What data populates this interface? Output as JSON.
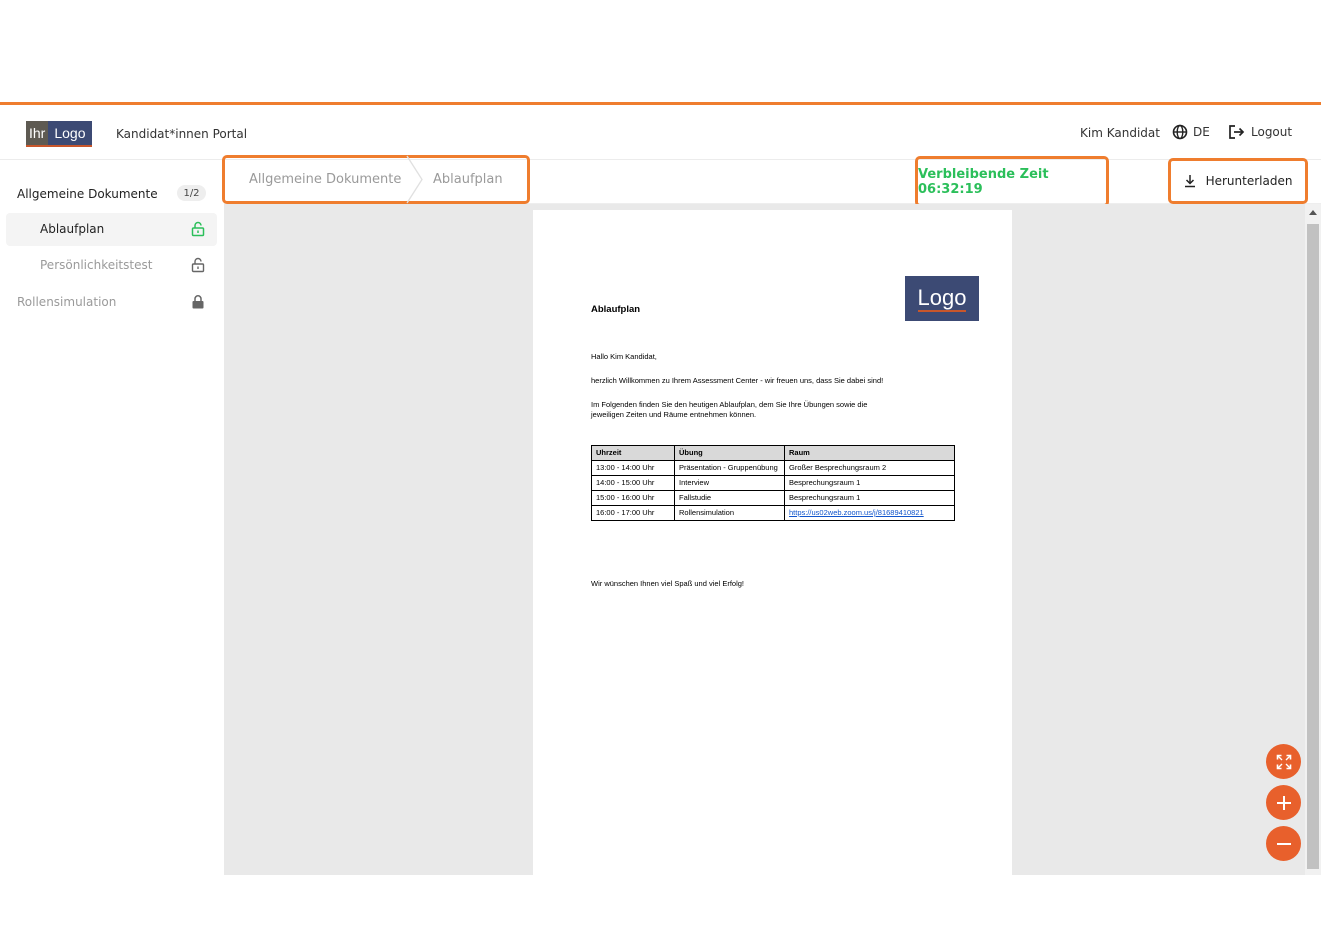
{
  "header": {
    "logo": {
      "part1": "Ihr",
      "part2": "Logo"
    },
    "portal_title": "Kandidat*innen Portal",
    "user_name": "Kim Kandidat",
    "language": "DE",
    "logout_label": "Logout"
  },
  "sidebar": {
    "section_title": "Allgemeine Dokumente",
    "counter": "1/2",
    "items": [
      {
        "label": "Ablaufplan",
        "icon": "unlock-icon",
        "state": "active"
      },
      {
        "label": "Persönlichkeitstest",
        "icon": "unlock-icon",
        "state": "inactive"
      }
    ],
    "locked_section": {
      "label": "Rollensimulation",
      "icon": "lock-icon"
    }
  },
  "toolbar": {
    "breadcrumb": [
      "Allgemeine Dokumente",
      "Ablaufplan"
    ],
    "timer": "Verbleibende Zeit 06:32:19",
    "download_label": "Herunterladen"
  },
  "document": {
    "logo": "Logo",
    "title": "Ablaufplan",
    "greeting": "Hallo Kim Kandidat,",
    "welcome": "herzlich Willkommen zu Ihrem Assessment Center - wir freuen uns, dass Sie dabei sind!",
    "intro_line1": "Im Folgenden finden Sie den heutigen Ablaufplan, dem Sie Ihre Übungen sowie die",
    "intro_line2": "jeweiligen Zeiten und Räume entnehmen können.",
    "table": {
      "headers": [
        "Uhrzeit",
        "Übung",
        "Raum"
      ],
      "rows": [
        [
          "13:00 - 14:00 Uhr",
          "Präsentation - Gruppenübung",
          "Großer Besprechungsraum 2"
        ],
        [
          "14:00 - 15:00 Uhr",
          "Interview",
          "Besprechungsraum 1"
        ],
        [
          "15:00 - 16:00 Uhr",
          "Fallstudie",
          "Besprechungsraum 1"
        ],
        [
          "16:00 - 17:00 Uhr",
          "Rollensimulation",
          "https://us02web.zoom.us/j/81689410821"
        ]
      ]
    },
    "closing": "Wir wünschen Ihnen viel Spaß und viel Erfolg!"
  },
  "colors": {
    "accent": "#ef7d2e",
    "timer_green": "#2bbf5a",
    "fab": "#e8602c",
    "logo_bg": "#3c4a74"
  },
  "controls": [
    "fullscreen-icon",
    "zoom-in-icon",
    "zoom-out-icon"
  ]
}
